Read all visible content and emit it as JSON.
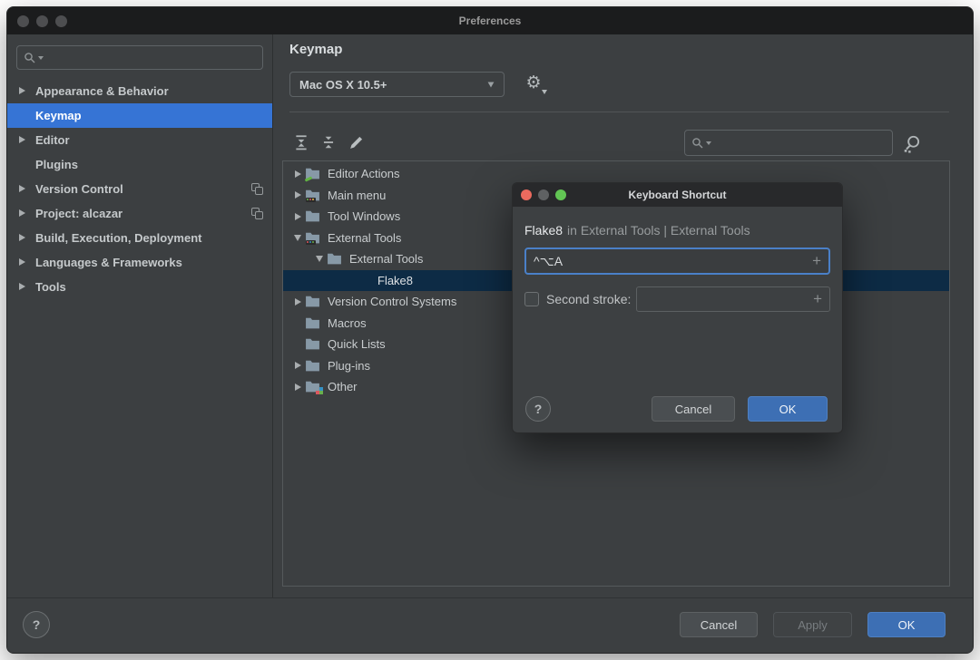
{
  "window": {
    "title": "Preferences"
  },
  "sidebar": {
    "items": [
      {
        "label": "Appearance & Behavior"
      },
      {
        "label": "Keymap"
      },
      {
        "label": "Editor"
      },
      {
        "label": "Plugins"
      },
      {
        "label": "Version Control"
      },
      {
        "label": "Project: alcazar"
      },
      {
        "label": "Build, Execution, Deployment"
      },
      {
        "label": "Languages & Frameworks"
      },
      {
        "label": "Tools"
      }
    ]
  },
  "main": {
    "title": "Keymap",
    "scheme_value": "Mac OS X 10.5+",
    "tree": {
      "items": [
        {
          "label": "Editor Actions"
        },
        {
          "label": "Main menu"
        },
        {
          "label": "Tool Windows"
        },
        {
          "label": "External Tools"
        },
        {
          "label": "External Tools"
        },
        {
          "label": "Flake8"
        },
        {
          "label": "Version Control Systems"
        },
        {
          "label": "Macros"
        },
        {
          "label": "Quick Lists"
        },
        {
          "label": "Plug-ins"
        },
        {
          "label": "Other"
        }
      ]
    }
  },
  "dialog": {
    "title": "Keyboard Shortcut",
    "subject": "Flake8",
    "context": "in External Tools | External Tools",
    "first_stroke_value": "^⌥A",
    "add_symbol": "+",
    "second_stroke_label": "Second stroke:",
    "help_label": "?",
    "cancel_label": "Cancel",
    "ok_label": "OK"
  },
  "footer": {
    "help_label": "?",
    "cancel_label": "Cancel",
    "apply_label": "Apply",
    "ok_label": "OK"
  },
  "icons": {
    "gear": "⚙"
  },
  "colors": {
    "sidebar_selection_blue": "#3674d5",
    "tree_selection_navy": "#0d2b45",
    "ok_button_blue": "#3d6fb4",
    "focus_ring_blue": "#4a80c8",
    "window_background": "#3c3f41",
    "titlebar_background": "#1b1c1d"
  }
}
